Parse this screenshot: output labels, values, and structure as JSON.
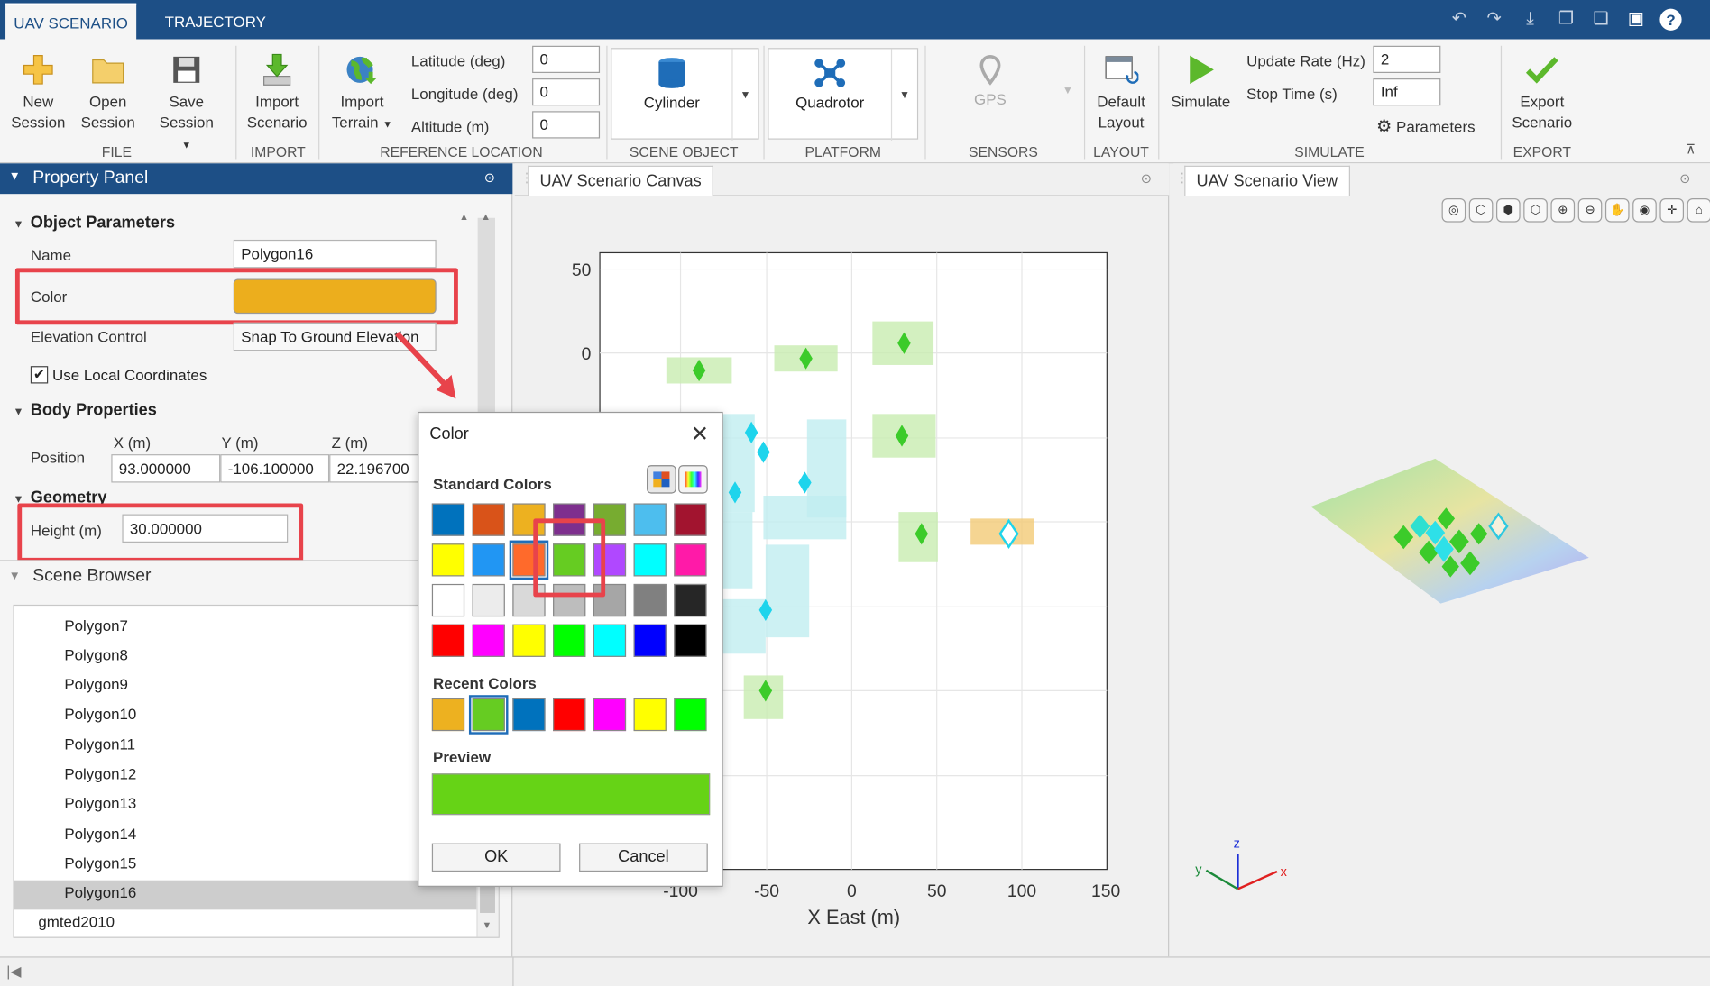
{
  "tabs": [
    "UAV SCENARIO",
    "TRAJECTORY"
  ],
  "toolstrip": {
    "file": {
      "new": [
        "New",
        "Session"
      ],
      "open": [
        "Open",
        "Session"
      ],
      "save": [
        "Save",
        "Session"
      ],
      "label": "FILE"
    },
    "import": {
      "scenario": [
        "Import",
        "Scenario"
      ],
      "terrain": [
        "Import",
        "Terrain"
      ],
      "label": "IMPORT"
    },
    "ref": {
      "lat_label": "Latitude (deg)",
      "lat": "0",
      "lon_label": "Longitude (deg)",
      "lon": "0",
      "alt_label": "Altitude (m)",
      "alt": "0",
      "label": "REFERENCE LOCATION"
    },
    "scene_object": {
      "item": "Cylinder",
      "label": "SCENE OBJECT"
    },
    "platform": {
      "item": "Quadrotor",
      "label": "PLATFORM"
    },
    "sensors": {
      "item": "GPS",
      "label": "SENSORS"
    },
    "layout": {
      "default": [
        "Default",
        "Layout"
      ],
      "label": "LAYOUT"
    },
    "simulate": {
      "simulate": "Simulate",
      "rate_label": "Update Rate (Hz)",
      "rate": "2",
      "stop_label": "Stop Time (s)",
      "stop": "Inf",
      "params": "Parameters",
      "label": "SIMULATE"
    },
    "export": {
      "export": [
        "Export",
        "Scenario"
      ],
      "label": "EXPORT"
    }
  },
  "property_panel": {
    "title": "Property Panel",
    "object_parameters": "Object Parameters",
    "name_label": "Name",
    "name": "Polygon16",
    "color_label": "Color",
    "color": "#ecae1d",
    "elev_label": "Elevation Control",
    "elev": "Snap To Ground Elevation",
    "use_local": "Use Local Coordinates",
    "body_properties": "Body Properties",
    "position_label": "Position",
    "x_label": "X (m)",
    "y_label": "Y (m)",
    "z_label": "Z (m)",
    "x": "93.000000",
    "y": "-106.100000",
    "z": "22.196700",
    "geometry": "Geometry",
    "height_label": "Height (m)",
    "height": "30.000000"
  },
  "scene_browser": {
    "title": "Scene Browser",
    "items": [
      "Polygon7",
      "Polygon8",
      "Polygon9",
      "Polygon10",
      "Polygon11",
      "Polygon12",
      "Polygon13",
      "Polygon14",
      "Polygon15",
      "Polygon16"
    ],
    "root": "gmted2010"
  },
  "canvas": {
    "title": "UAV Scenario Canvas",
    "xlabel": "X East (m)",
    "xticks": [
      "-100",
      "-50",
      "0",
      "50",
      "100",
      "150"
    ],
    "yticks": [
      "50",
      "0"
    ]
  },
  "view": {
    "title": "UAV Scenario View",
    "axes": {
      "x": "x",
      "y": "y",
      "z": "z"
    }
  },
  "dialog": {
    "title": "Color",
    "standard_colors": "Standard Colors",
    "recent_colors": "Recent Colors",
    "preview": "Preview",
    "ok": "OK",
    "cancel": "Cancel",
    "standard": [
      "#0072bd",
      "#d95319",
      "#edb120",
      "#7e2f8e",
      "#77ac30",
      "#4dbeee",
      "#a2142f",
      "#ffff00",
      "#2196f3",
      "#ff6a2b",
      "#66cc22",
      "#b048ff",
      "#00ffff",
      "#ff1aa8",
      "#ffffff",
      "#ececec",
      "#d9d9d9",
      "#bdbdbd",
      "#a6a6a6",
      "#808080",
      "#262626",
      "#ff0000",
      "#ff00ff",
      "#ffff00",
      "#00ff00",
      "#00ffff",
      "#0000ff",
      "#000000"
    ],
    "recent": [
      "#edb120",
      "#66cc22",
      "#0072bd",
      "#ff0000",
      "#ff00ff",
      "#ffff00",
      "#00ff00"
    ],
    "preview_color": "#66d316"
  }
}
